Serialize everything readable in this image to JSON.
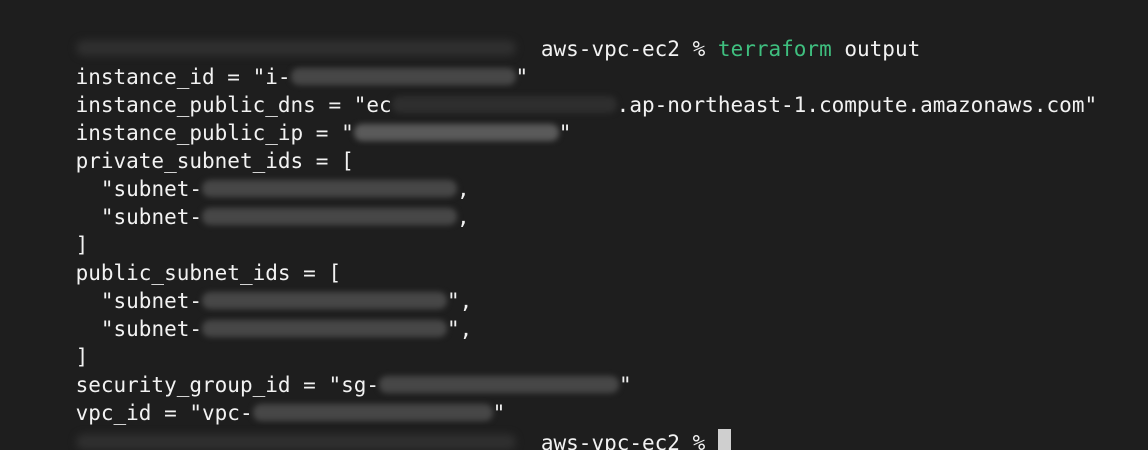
{
  "terminal": {
    "prompt": {
      "directory": "aws-vpc-ec2",
      "symbol": "%",
      "command": "terraform",
      "argument": "output"
    },
    "outputs": {
      "instance_id": {
        "key": "instance_id",
        "prefix": "\"i-",
        "suffix": "\""
      },
      "instance_public_dns": {
        "key": "instance_public_dns",
        "prefix": "\"ec",
        "suffix": ".ap-northeast-1.compute.amazonaws.com\""
      },
      "instance_public_ip": {
        "key": "instance_public_ip",
        "prefix": "\"",
        "suffix": "\""
      },
      "private_subnet_ids": {
        "key": "private_subnet_ids",
        "items": [
          {
            "prefix": "\"subnet-",
            "suffix": ","
          },
          {
            "prefix": "\"subnet-",
            "suffix": ","
          }
        ]
      },
      "public_subnet_ids": {
        "key": "public_subnet_ids",
        "items": [
          {
            "prefix": "\"subnet-",
            "suffix": "\","
          },
          {
            "prefix": "\"subnet-",
            "suffix": "\","
          }
        ]
      },
      "security_group_id": {
        "key": "security_group_id",
        "prefix": "\"sg-",
        "suffix": "\""
      },
      "vpc_id": {
        "key": "vpc_id",
        "prefix": "\"vpc-",
        "suffix": "\""
      }
    },
    "syntax": {
      "equals": " = ",
      "open_bracket": "[",
      "close_bracket": "]",
      "indent": "  "
    }
  }
}
